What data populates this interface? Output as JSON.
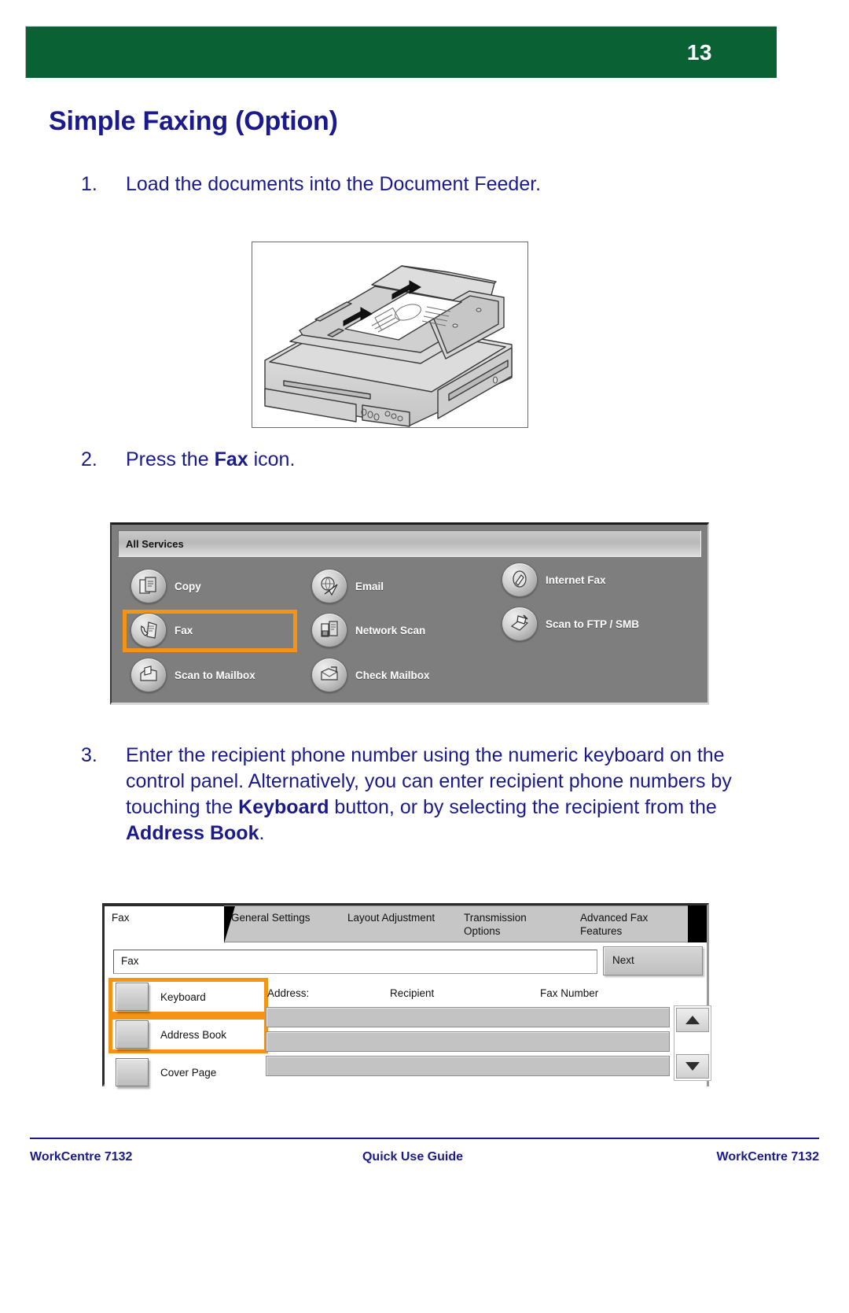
{
  "header": {
    "page_number": "13",
    "band_color": "#0a6134"
  },
  "page_title": "Simple Faxing (Option)",
  "accent_color": "#f59414",
  "text_color": "#1a1a8c",
  "steps": [
    {
      "number": "1.",
      "text_before": "Load the documents into the Document Feeder.",
      "bold": "",
      "text_after": ""
    },
    {
      "number": "2.",
      "text_before": "Press the ",
      "bold": "Fax",
      "text_after": " icon."
    },
    {
      "number": "3.",
      "text_before": "Enter the recipient phone number using the numeric keyboard on the control panel.  Alternatively, you can enter recipient phone numbers by touching the ",
      "bold": "Keyboard",
      "text_mid": " button, or by selecting the recipient from the ",
      "bold2": "Address Book",
      "text_after": "."
    }
  ],
  "illustration": {
    "caption": "copier-with-document-feeder-illustration"
  },
  "all_services": {
    "title": "All Services",
    "items": [
      {
        "label": "Copy",
        "icon": "copy-icon",
        "highlighted": false
      },
      {
        "label": "Email",
        "icon": "email-icon",
        "highlighted": false
      },
      {
        "label": "Internet Fax",
        "icon": "internet-fax-icon",
        "highlighted": false
      },
      {
        "label": "Fax",
        "icon": "fax-icon",
        "highlighted": true
      },
      {
        "label": "Network Scan",
        "icon": "network-scan-icon",
        "highlighted": false
      },
      {
        "label": "Scan to FTP / SMB",
        "icon": "scan-to-ftp-icon",
        "highlighted": false
      },
      {
        "label": "Scan to Mailbox",
        "icon": "scan-to-mailbox-icon",
        "highlighted": false
      },
      {
        "label": "Check Mailbox",
        "icon": "check-mailbox-icon",
        "highlighted": false
      }
    ]
  },
  "fax_screen": {
    "tabs": [
      {
        "label": "Fax",
        "active": true
      },
      {
        "label": "General Settings",
        "active": false
      },
      {
        "label": "Layout Adjustment",
        "active": false
      },
      {
        "label": "Transmission\nOptions",
        "line1": "Transmission",
        "line2": "Options",
        "active": false
      },
      {
        "label": "Advanced Fax\nFeatures",
        "line1": "Advanced Fax",
        "line2": "Features",
        "active": false
      }
    ],
    "address_field_value": "Fax",
    "next_button": "Next",
    "side_buttons": [
      {
        "label": "Keyboard",
        "highlighted": true
      },
      {
        "label": "Address Book",
        "highlighted": true
      },
      {
        "label": "Cover Page",
        "highlighted": false
      }
    ],
    "columns": {
      "address": "Address:",
      "recipient": "Recipient",
      "fax_number": "Fax Number"
    },
    "scroll_up": "scroll-up-arrow",
    "scroll_down": "scroll-down-arrow",
    "rows": [
      "",
      "",
      ""
    ]
  },
  "footer": {
    "left": "WorkCentre 7132",
    "center": "Quick Use Guide",
    "right": "WorkCentre 7132"
  }
}
